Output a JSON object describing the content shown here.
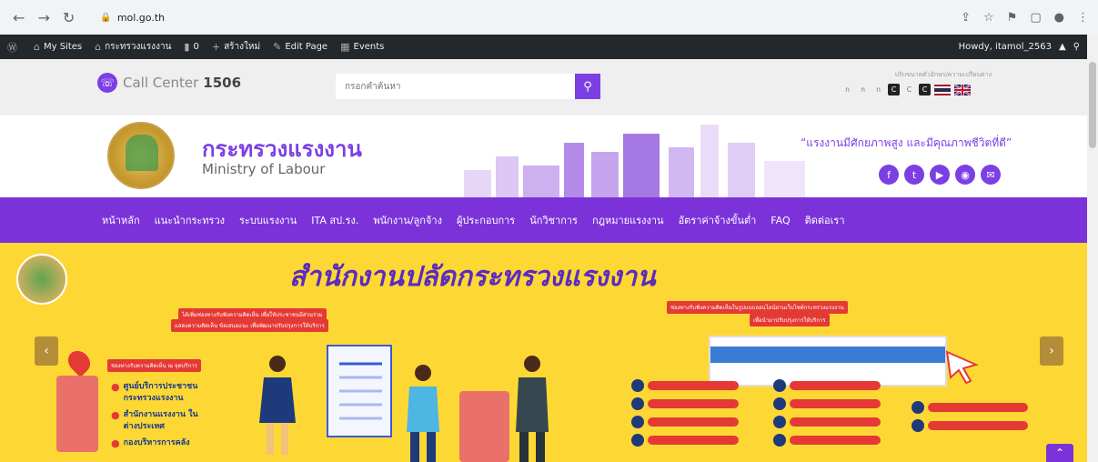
{
  "browser": {
    "url": "mol.go.th",
    "back_icon": "back-arrow-icon",
    "forward_icon": "forward-arrow-icon",
    "reload_icon": "reload-icon"
  },
  "wp_admin": {
    "my_sites": "My Sites",
    "site_name": "กระทรวงแรงงาน",
    "comments": "0",
    "new": "สร้างใหม่",
    "edit_page": "Edit Page",
    "events": "Events",
    "howdy": "Howdy, itamol_2563"
  },
  "topbar": {
    "call_center_label": "Call Center",
    "call_center_number": "1506",
    "search_placeholder": "กรอกคำค้นหา",
    "accessibility_label": "ปรับขนาดตัวอักษร/ความเปรียบต่าง",
    "access_items": [
      "ก",
      "ก",
      "ก",
      "C",
      "C",
      "C"
    ]
  },
  "header": {
    "ministry_th": "กระทรวงแรงงาน",
    "ministry_en": "Ministry of Labour",
    "slogan": "“แรงงานมีศักยภาพสูง และมีคุณภาพชีวิตที่ดี”"
  },
  "menu": {
    "items": [
      "หน้าหลัก",
      "แนะนำกระทรวง",
      "ระบบแรงงาน",
      "ITA สป.รง.",
      "พนักงาน/ลูกจ้าง",
      "ผู้ประกอบการ",
      "นักวิชาการ",
      "กฎหมายแรงงาน",
      "อัตราค่าจ้างขั้นต่ำ",
      "FAQ",
      "ติดต่อเรา"
    ]
  },
  "banner": {
    "title": "สำนักงานปลัดกระทรวงแรงงาน",
    "left_text_1": "ได้เพิ่มช่องทางรับฟังความคิดเห็น เพื่อให้ประชาชนมีส่วนร่วม",
    "left_text_2": "แสดงความคิดเห็น ข้อเสนอแนะ เพื่อพัฒนาปรับปรุงการให้บริการ",
    "right_text_1": "ช่องทางรับฟังความคิดเห็นในรูปแบบออนไลน์ผ่านเว็บไซต์กระทรวงแรงงาน",
    "right_text_2": "เพื่อนำมาปรับปรุงการให้บริการ",
    "channels_label": "ช่องทางรับความคิดเห็น ณ จุดบริการ",
    "bullets": [
      "ศูนย์บริการประชาชน กระทรวงแรงงาน",
      "สำนักงานแรงงาน ในต่างประเทศ",
      "กองบริหารการคลัง"
    ]
  }
}
